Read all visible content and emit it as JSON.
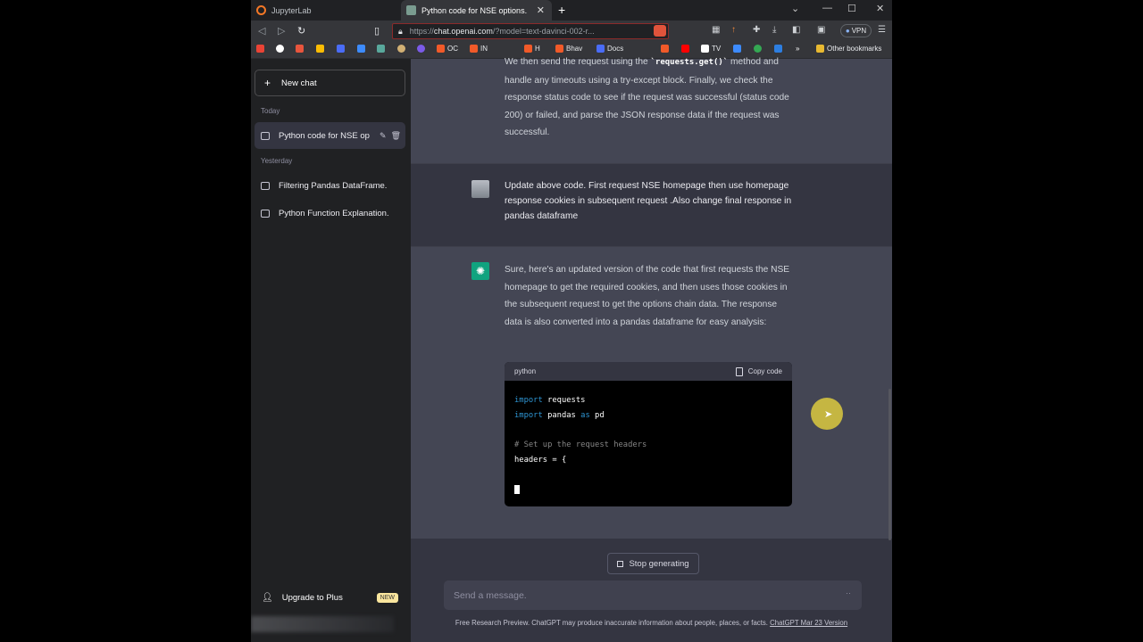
{
  "browser": {
    "tabs": [
      {
        "label": "JupyterLab",
        "active": false
      },
      {
        "label": "Python code for NSE options.",
        "active": true
      }
    ],
    "url_host": "chat.openai.com",
    "url_prefix": "https://",
    "url_rest": "/?model=text-davinci-002-r...",
    "vpn_label": "VPN",
    "bookmarks": [
      "OC",
      "IN",
      "H",
      "Bhav",
      "Docs",
      "TV"
    ],
    "other_bookmarks": "Other bookmarks"
  },
  "sidebar": {
    "new_chat": "New chat",
    "today_label": "Today",
    "yesterday_label": "Yesterday",
    "today_items": [
      {
        "label": "Python code for NSE op"
      }
    ],
    "yesterday_items": [
      {
        "label": "Filtering Pandas DataFrame."
      },
      {
        "label": "Python Function Explanation."
      }
    ],
    "upgrade": "Upgrade to Plus",
    "new_badge": "NEW"
  },
  "chat": {
    "prev_ai_line1_pre": "We then send the request using the ",
    "prev_ai_line1_code": "`requests.get()`",
    "prev_ai_line1_post": " method",
    "prev_ai_rest": "and handle any timeouts using a try-except block. Finally, we check the response status code to see if the request was successful (status code 200) or failed, and parse the JSON response data if the request was successful.",
    "user_message": "Update above code. First request NSE homepage then use homepage response cookies in subsequent request .Also change final response in pandas dataframe",
    "ai_message": "Sure, here's an updated version of the code that first requests the NSE homepage to get the required cookies, and then uses those cookies in the subsequent request to get the options chain data. The response data is also converted into a pandas dataframe for easy analysis:",
    "code_lang": "python",
    "copy_label": "Copy code",
    "code": {
      "l1_kw": "import",
      "l1_rest": " requests",
      "l2_kw": "import",
      "l2_mid": " pandas ",
      "l2_kw2": "as",
      "l2_rest": " pd",
      "l4_comment": "# Set up the request headers",
      "l5": "headers = {"
    }
  },
  "composer": {
    "stop_label": "Stop generating",
    "placeholder": "Send a message.",
    "footer_text": "Free Research Preview. ChatGPT may produce inaccurate information about people, places, or facts. ",
    "footer_link": "ChatGPT Mar 23 Version"
  }
}
